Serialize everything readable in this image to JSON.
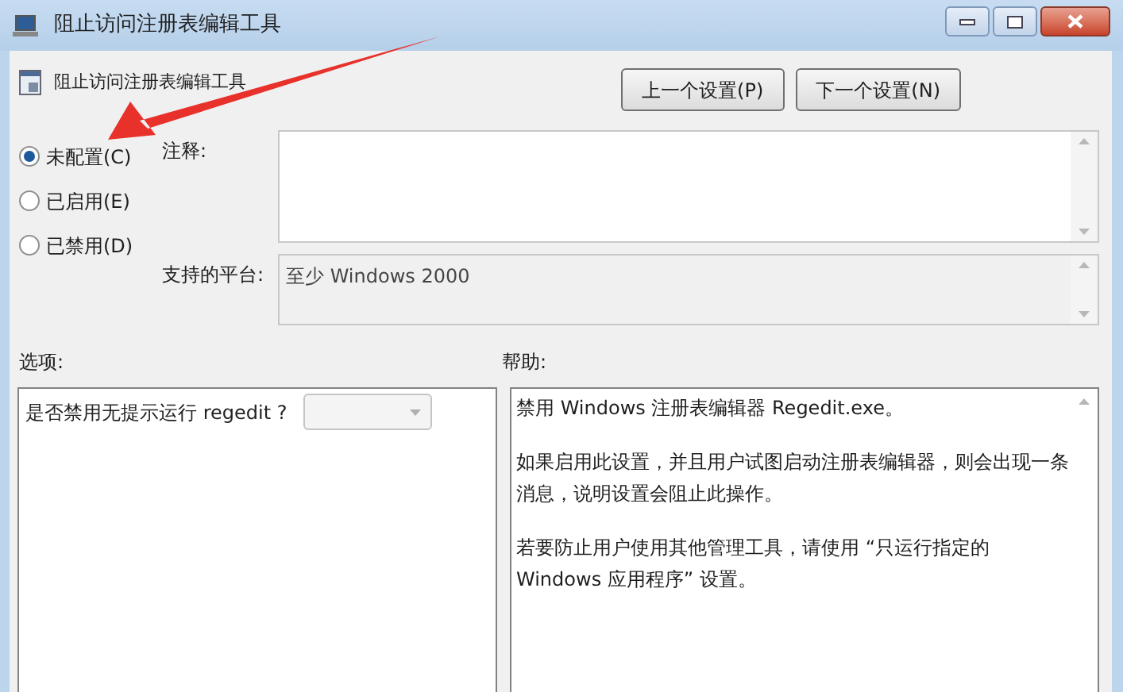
{
  "window": {
    "title": "阻止访问注册表编辑工具"
  },
  "policy_title": "阻止访问注册表编辑工具",
  "nav_buttons": [
    "上一个设置(P)",
    "下一个设置(N)"
  ],
  "states": [
    {
      "label": "未配置(C)",
      "selected": true
    },
    {
      "label": "已启用(E)",
      "selected": false
    },
    {
      "label": "已禁用(D)",
      "selected": false
    }
  ],
  "comment": {
    "label": "注释:"
  },
  "platform": {
    "label": "支持的平台:",
    "value": "至少 Windows 2000"
  },
  "options": {
    "label": "选项:",
    "items": [
      {
        "label": "是否禁用无提示运行 regedit ?",
        "disabled": true
      }
    ]
  },
  "help": {
    "label": "帮助:",
    "paragraphs": [
      [
        "禁用 Windows 注册表编辑器 Regedit.exe。"
      ],
      [
        "如果启用此设置，并且用户试图启动注册表编辑器，则会出现一条",
        "消息，说明设置会阻止此操作。"
      ],
      [
        "若要防止用户使用其他管理工具，请使用 “只运行指定的",
        "Windows 应用程序” 设置。"
      ]
    ]
  }
}
